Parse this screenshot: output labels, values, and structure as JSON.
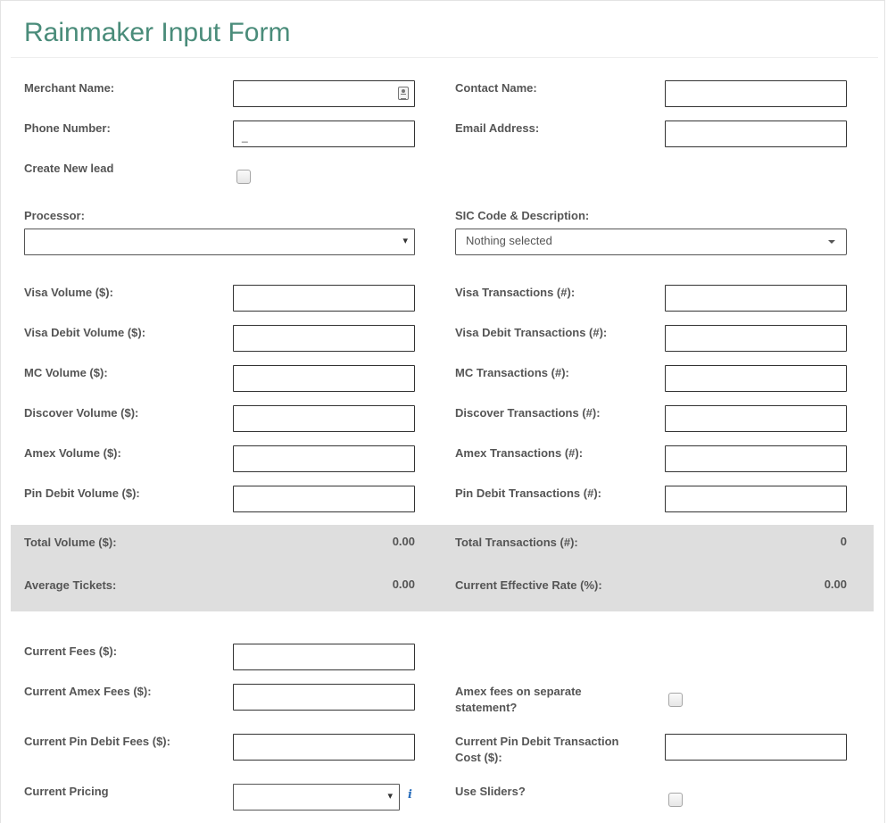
{
  "form": {
    "title": "Rainmaker Input Form"
  },
  "fields": {
    "merchant_name": {
      "label": "Merchant Name:",
      "value": ""
    },
    "contact_name": {
      "label": "Contact Name:",
      "value": ""
    },
    "phone_number": {
      "label": "Phone Number:",
      "mask": "_"
    },
    "email_address": {
      "label": "Email Address:",
      "value": ""
    },
    "create_new_lead": {
      "label": "Create New lead",
      "checked": false
    },
    "processor": {
      "label": "Processor:",
      "selected": ""
    },
    "sic_code": {
      "label": "SIC Code & Description:",
      "selected": "Nothing selected"
    },
    "visa_volume": {
      "label": "Visa Volume ($):"
    },
    "visa_transactions": {
      "label": "Visa Transactions (#):"
    },
    "visa_debit_volume": {
      "label": "Visa Debit Volume ($):"
    },
    "visa_debit_transactions": {
      "label": "Visa Debit Transactions (#):"
    },
    "mc_volume": {
      "label": "MC Volume ($):"
    },
    "mc_transactions": {
      "label": "MC Transactions (#):"
    },
    "discover_volume": {
      "label": "Discover Volume ($):"
    },
    "discover_transactions": {
      "label": "Discover Transactions (#):"
    },
    "amex_volume": {
      "label": "Amex Volume ($):"
    },
    "amex_transactions": {
      "label": "Amex Transactions (#):"
    },
    "pin_debit_volume": {
      "label": "Pin Debit Volume ($):"
    },
    "pin_debit_transactions": {
      "label": "Pin Debit Transactions (#):"
    },
    "current_fees": {
      "label": "Current Fees ($):"
    },
    "current_amex_fees": {
      "label": "Current Amex Fees ($):"
    },
    "amex_separate": {
      "label_line1": "Amex fees on separate",
      "label_line2": "statement?",
      "checked": false
    },
    "current_pin_debit_fees": {
      "label": "Current Pin Debit Fees ($):"
    },
    "current_pin_debit_cost": {
      "label_line1": "Current Pin Debit Transaction",
      "label_line2": "Cost ($):"
    },
    "current_pricing": {
      "label": "Current Pricing",
      "selected": ""
    },
    "use_sliders": {
      "label": "Use Sliders?",
      "checked": false
    }
  },
  "summary": {
    "total_volume": {
      "label": "Total Volume ($):",
      "value": "0.00"
    },
    "total_transactions": {
      "label": "Total Transactions (#):",
      "value": "0"
    },
    "average_tickets": {
      "label": "Average Tickets:",
      "value": "0.00"
    },
    "effective_rate": {
      "label": "Current Effective Rate (%):",
      "value": "0.00"
    }
  },
  "icons": {
    "dropdown_caret": "▾",
    "info": "i"
  },
  "colors": {
    "title": "#4a8c7a",
    "summary_bg": "#dedede",
    "info_icon": "#2a6ebb"
  }
}
